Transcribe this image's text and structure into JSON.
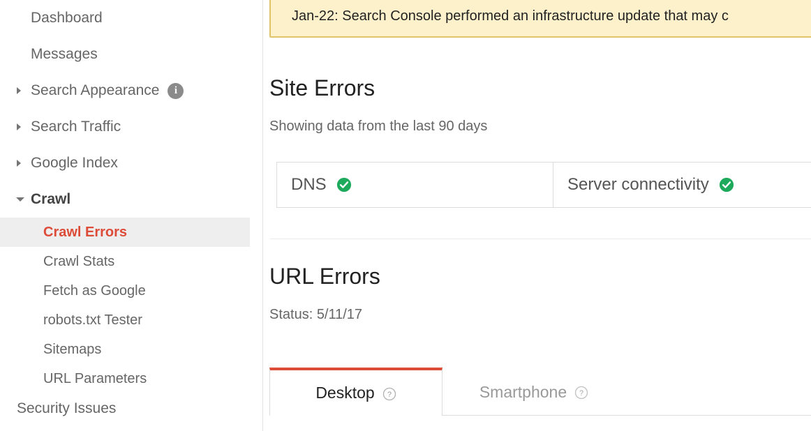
{
  "sidebar": {
    "items": [
      {
        "label": "Dashboard",
        "caret": "none",
        "type": "top"
      },
      {
        "label": "Messages",
        "caret": "none",
        "type": "top"
      },
      {
        "label": "Search Appearance",
        "caret": "collapsed",
        "type": "top",
        "badge_icon": "info-icon"
      },
      {
        "label": "Search Traffic",
        "caret": "collapsed",
        "type": "top"
      },
      {
        "label": "Google Index",
        "caret": "collapsed",
        "type": "top"
      },
      {
        "label": "Crawl",
        "caret": "expanded",
        "type": "top",
        "expanded": true
      }
    ],
    "crawl_children": [
      {
        "label": "Crawl Errors",
        "active": true
      },
      {
        "label": "Crawl Stats",
        "active": false
      },
      {
        "label": "Fetch as Google",
        "active": false
      },
      {
        "label": "robots.txt Tester",
        "active": false
      },
      {
        "label": "Sitemaps",
        "active": false
      },
      {
        "label": "URL Parameters",
        "active": false
      }
    ],
    "footer_items": [
      {
        "label": "Security Issues"
      }
    ],
    "active_color": "#dd4b39",
    "active_bg": "#eeeeee"
  },
  "banner": {
    "text": "Jan-22: Search Console performed an infrastructure update that may c",
    "background": "#fcf1ca",
    "border_color": "#e0c469"
  },
  "site_errors": {
    "title": "Site Errors",
    "subtitle": "Showing data from the last 90 days",
    "cells": [
      {
        "label": "DNS",
        "status_icon": "check-circle-icon",
        "status_color": "#1eaa5c"
      },
      {
        "label": "Server connectivity",
        "status_icon": "check-circle-icon",
        "status_color": "#1eaa5c"
      }
    ]
  },
  "url_errors": {
    "title": "URL Errors",
    "status_label": "Status: 5/11/17",
    "tabs": [
      {
        "label": "Desktop",
        "active": true,
        "help_icon": "help-circle-icon"
      },
      {
        "label": "Smartphone",
        "active": false,
        "help_icon": "help-circle-icon"
      }
    ],
    "active_tab_accent": "#dd4b39"
  }
}
